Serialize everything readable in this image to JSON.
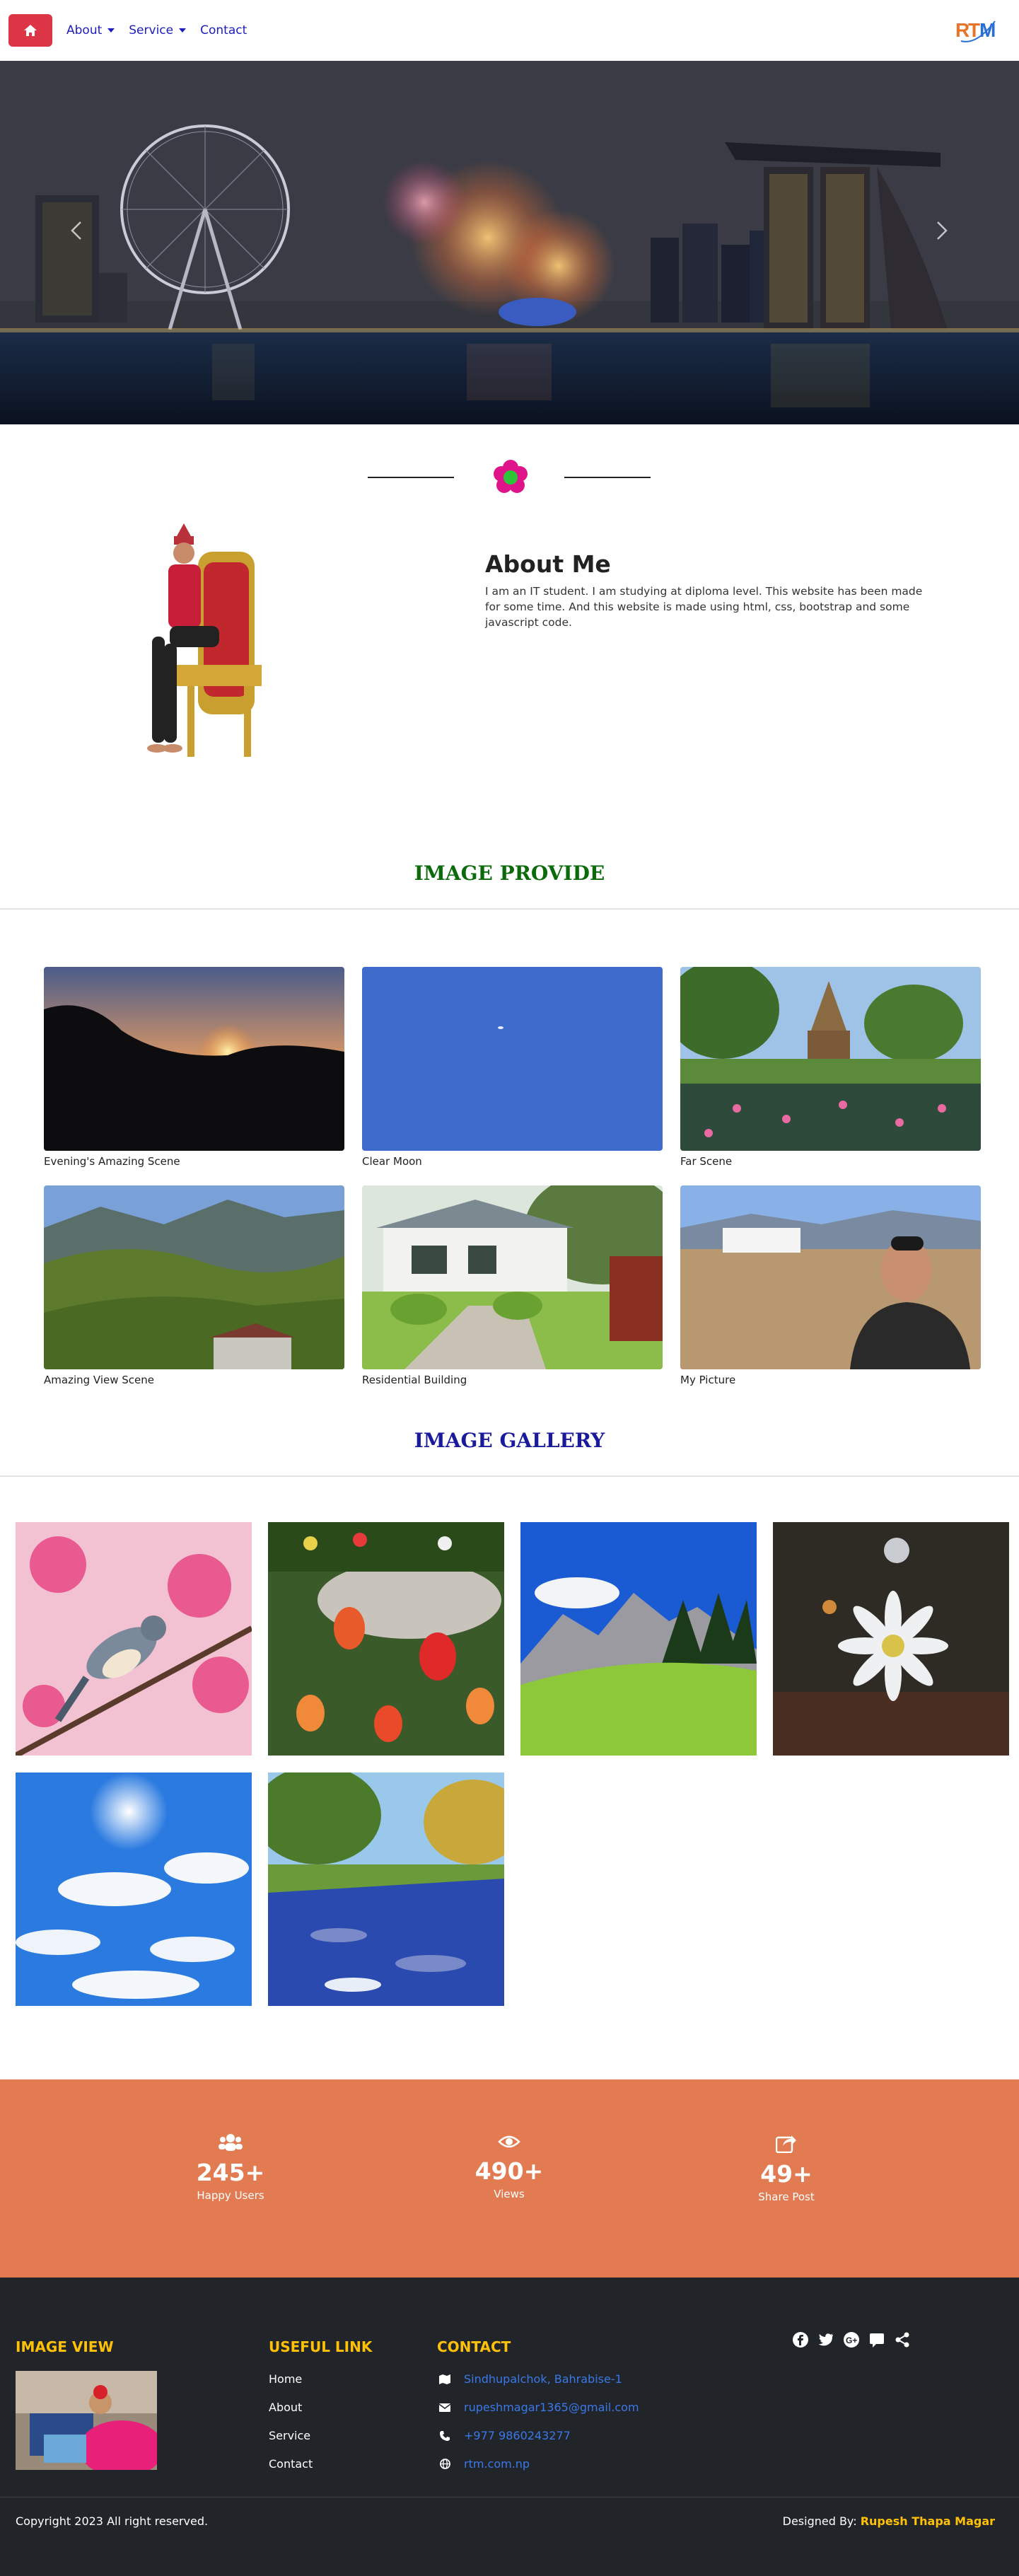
{
  "nav": {
    "home_icon": "home-icon",
    "items": [
      {
        "label": "About",
        "dropdown": true
      },
      {
        "label": "Service",
        "dropdown": true
      },
      {
        "label": "Contact",
        "dropdown": false
      }
    ],
    "logo_text": "RTM"
  },
  "about": {
    "title": "About Me",
    "text": "I am an IT student. I am studying at diploma level. This website has been made for some time. And this website is made using html, css, bootstrap and some javascript code."
  },
  "provide": {
    "title": "IMAGE PROVIDE",
    "title_color": "#0b6b0b",
    "cards": [
      {
        "caption": "Evening's Amazing Scene"
      },
      {
        "caption": "Clear Moon"
      },
      {
        "caption": "Far Scene"
      },
      {
        "caption": "Amazing View Scene"
      },
      {
        "caption": "Residential Building"
      },
      {
        "caption": "My Picture"
      }
    ]
  },
  "gallery": {
    "title": "IMAGE GALLERY",
    "title_color": "#1a1a9c"
  },
  "stats": [
    {
      "icon": "users-icon",
      "value": "245+",
      "label": "Happy Users"
    },
    {
      "icon": "eye-icon",
      "value": "490+",
      "label": "Views"
    },
    {
      "icon": "share-icon",
      "value": "49+",
      "label": "Share Post"
    }
  ],
  "footer": {
    "image_view_title": "IMAGE VIEW",
    "useful_title": "USEFUL LINK",
    "useful_links": [
      "Home",
      "About",
      "Service",
      "Contact"
    ],
    "contact_title": "CONTACT",
    "contacts": [
      {
        "icon": "map-icon",
        "text": "Sindhupalchok, Bahrabise-1"
      },
      {
        "icon": "envelope-icon",
        "text": "rupeshmagar1365@gmail.com"
      },
      {
        "icon": "phone-icon",
        "text": "+977 9860243277"
      },
      {
        "icon": "globe-icon",
        "text": "rtm.com.np"
      }
    ],
    "social_icons": [
      "facebook-icon",
      "twitter-icon",
      "google-plus-icon",
      "comment-icon",
      "share-alt-icon"
    ],
    "copyright": "Copyright 2023 All right reserved.",
    "designed_prefix": "Designed By:",
    "designer": "Rupesh Thapa Magar"
  },
  "colors": {
    "home_button": "#dc3545",
    "stats_bg": "#e27b52",
    "footer_bg": "#212529",
    "footer_heading": "#ffc107",
    "contact_link": "#3a78e8"
  }
}
